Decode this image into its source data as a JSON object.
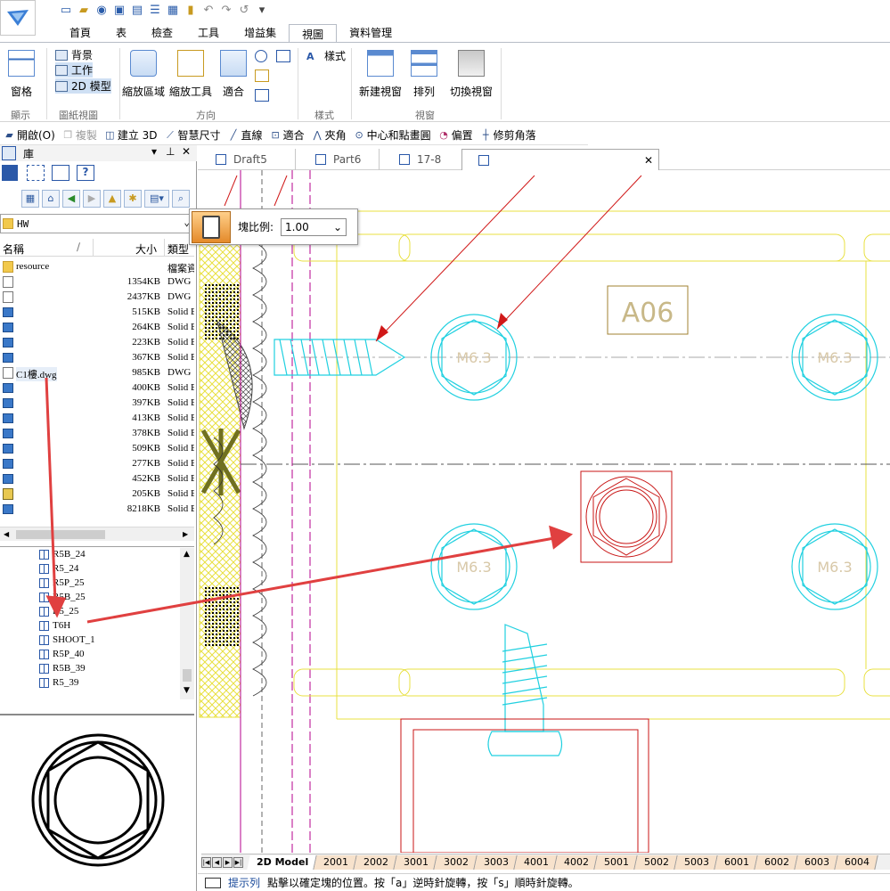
{
  "app": {
    "title": ""
  },
  "ribbon_tabs": [
    "首頁",
    "表",
    "檢查",
    "工具",
    "增益集",
    "視圖",
    "資料管理"
  ],
  "ribbon": {
    "window_label": "窗格",
    "window_group": "顯示",
    "background": "背景",
    "working": "工作",
    "model2d": "2D 模型",
    "sheet_group": "圖紙視圖",
    "zoom_area": "縮放區域",
    "zoom_tool": "縮放工具",
    "fit": "適合",
    "orient_group": "方向",
    "style": "樣式",
    "style_group": "樣式",
    "new_window": "新建視窗",
    "arrange": "排列",
    "window_group2": "視窗",
    "switch_window": "切換視窗"
  },
  "command_bar": [
    {
      "label": "開啟(O)",
      "icon": "open-icon",
      "disabled": false
    },
    {
      "label": "複製",
      "icon": "copy-icon",
      "disabled": true
    },
    {
      "label": "建立 3D",
      "icon": "create-3d-icon",
      "disabled": false
    },
    {
      "label": "智慧尺寸",
      "icon": "smart-dimension-icon",
      "disabled": false
    },
    {
      "label": "直線",
      "icon": "line-icon",
      "disabled": false
    },
    {
      "label": "適合",
      "icon": "fit-icon",
      "disabled": false
    },
    {
      "label": "夾角",
      "icon": "angle-icon",
      "disabled": false
    },
    {
      "label": "中心和點畫圓",
      "icon": "circle-icon",
      "disabled": false
    },
    {
      "label": "偏置",
      "icon": "offset-icon",
      "disabled": false
    },
    {
      "label": "修剪角落",
      "icon": "trim-corner-icon",
      "disabled": false
    }
  ],
  "library": {
    "title": "庫",
    "path": "HW",
    "col_name": "名稱",
    "col_size": "大小",
    "col_type": "類型",
    "files": [
      {
        "name": "resource",
        "size": "",
        "type": "檔案資料夾",
        "kind": "folder"
      },
      {
        "name": "",
        "size": "1354KB",
        "type": "DWG",
        "kind": "dwg"
      },
      {
        "name": "",
        "size": "2437KB",
        "type": "DWG",
        "kind": "dwg"
      },
      {
        "name": "",
        "size": "515KB",
        "type": "Solid Edge",
        "kind": "solid"
      },
      {
        "name": "",
        "size": "264KB",
        "type": "Solid Edge",
        "kind": "solid"
      },
      {
        "name": "",
        "size": "223KB",
        "type": "Solid Edge",
        "kind": "solid"
      },
      {
        "name": "",
        "size": "367KB",
        "type": "Solid Edge",
        "kind": "solid"
      },
      {
        "name": "C1樓.dwg",
        "size": "985KB",
        "type": "DWG",
        "kind": "dwg"
      },
      {
        "name": "",
        "size": "400KB",
        "type": "Solid Edge",
        "kind": "solid"
      },
      {
        "name": "",
        "size": "397KB",
        "type": "Solid Edge",
        "kind": "solid"
      },
      {
        "name": "",
        "size": "413KB",
        "type": "Solid Edge",
        "kind": "solid"
      },
      {
        "name": "",
        "size": "378KB",
        "type": "Solid Edge",
        "kind": "solid"
      },
      {
        "name": "",
        "size": "509KB",
        "type": "Solid Edge",
        "kind": "solid"
      },
      {
        "name": "",
        "size": "277KB",
        "type": "Solid Edge",
        "kind": "solid"
      },
      {
        "name": "",
        "size": "452KB",
        "type": "Solid Edge",
        "kind": "solid"
      },
      {
        "name": "",
        "size": "205KB",
        "type": "Solid Edge",
        "kind": "dwgasm"
      },
      {
        "name": "",
        "size": "8218KB",
        "type": "Solid Edge",
        "kind": "solid"
      }
    ],
    "blocks": [
      "R5B_24",
      "R5_24",
      "R5P_25",
      "R5B_25",
      "R5_25",
      "T6H",
      "SHOOT_1",
      "R5P_40",
      "R5B_39",
      "R5_39"
    ]
  },
  "doc_tabs": [
    {
      "label": "Draft5",
      "active": false
    },
    {
      "label": "Part6",
      "active": false
    },
    {
      "label": "17-8",
      "active": false
    },
    {
      "label": "",
      "active": true
    }
  ],
  "scale_popup": {
    "label": "塊比例:",
    "value": "1.00"
  },
  "drawing": {
    "tag": "A06",
    "bolt_label": "M6.3"
  },
  "sheet_tabs": [
    "2D Model",
    "2001",
    "2002",
    "3001",
    "3002",
    "3003",
    "4001",
    "4002",
    "5001",
    "5002",
    "5003",
    "6001",
    "6002",
    "6003",
    "6004"
  ],
  "status": {
    "hint": "提示列",
    "message": "點擊以確定塊的位置。按「a」逆時針旋轉，按「s」順時針旋轉。"
  }
}
